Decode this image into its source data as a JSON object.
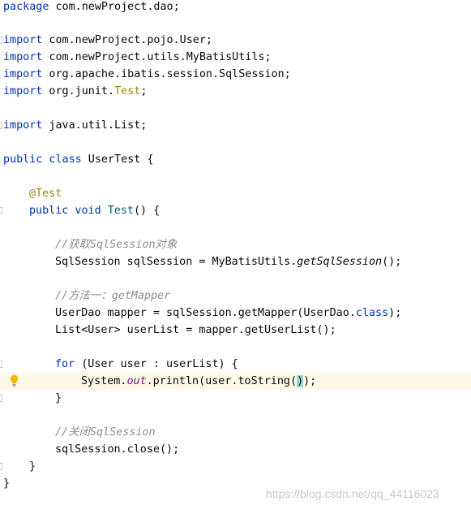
{
  "code": {
    "l1_kw": "package",
    "l1_rest": " com.newProject.dao;",
    "l3_kw": "import",
    "l3_rest": " com.newProject.pojo.User;",
    "l4_kw": "import",
    "l4_rest": " com.newProject.utils.MyBatisUtils;",
    "l5_kw": "import",
    "l5_rest": " org.apache.ibatis.session.SqlSession;",
    "l6_kw": "import",
    "l6_rest": " org.junit.",
    "l6_test": "Test",
    "l6_end": ";",
    "l8_kw": "import",
    "l8_rest": " java.util.List;",
    "l10_kw": "public class",
    "l10_rest": " UserTest {",
    "l12_ann": "@Test",
    "l13_kw": "public void",
    "l13_fn": "Test",
    "l13_rest": "() {",
    "l15_cmt_slash": "//",
    "l15_cmt_cn1": "获取",
    "l15_cmt_en": "SqlSession",
    "l15_cmt_cn2": "对象",
    "l16_a": "SqlSession sqlSession = MyBatisUtils.",
    "l16_call": "getSqlSession",
    "l16_b": "();",
    "l18_cmt_slash": "//",
    "l18_cmt_cn": "方法一：",
    "l18_cmt_en": "getMapper",
    "l19_a": "UserDao mapper = sqlSession.getMapper(UserDao.",
    "l19_kw": "class",
    "l19_b": ");",
    "l20": "List<User> userList = mapper.getUserList();",
    "l22_kw": "for",
    "l22_rest": " (User user : userList) {",
    "l23_a": "System.",
    "l23_out": "out",
    "l23_b": ".println(user.toString(",
    "l23_match": ")",
    "l23_c": ");",
    "l24": "}",
    "l26_cmt_slash": "//",
    "l26_cmt_cn": "关闭",
    "l26_cmt_en": "SqlSession",
    "l27": "sqlSession.close();",
    "l28": "}",
    "l29": "}"
  },
  "watermark": "https://blog.csdn.net/qq_44116023",
  "icons": {
    "intention_bulb": "lightbulb-icon"
  },
  "colors": {
    "keyword": "#0033b3",
    "annotation": "#9e880d",
    "method": "#00627a",
    "comment": "#8c8c8c",
    "static_field": "#871094",
    "caret_row": "#fcfae7",
    "brace_match": "#93d9d9"
  }
}
